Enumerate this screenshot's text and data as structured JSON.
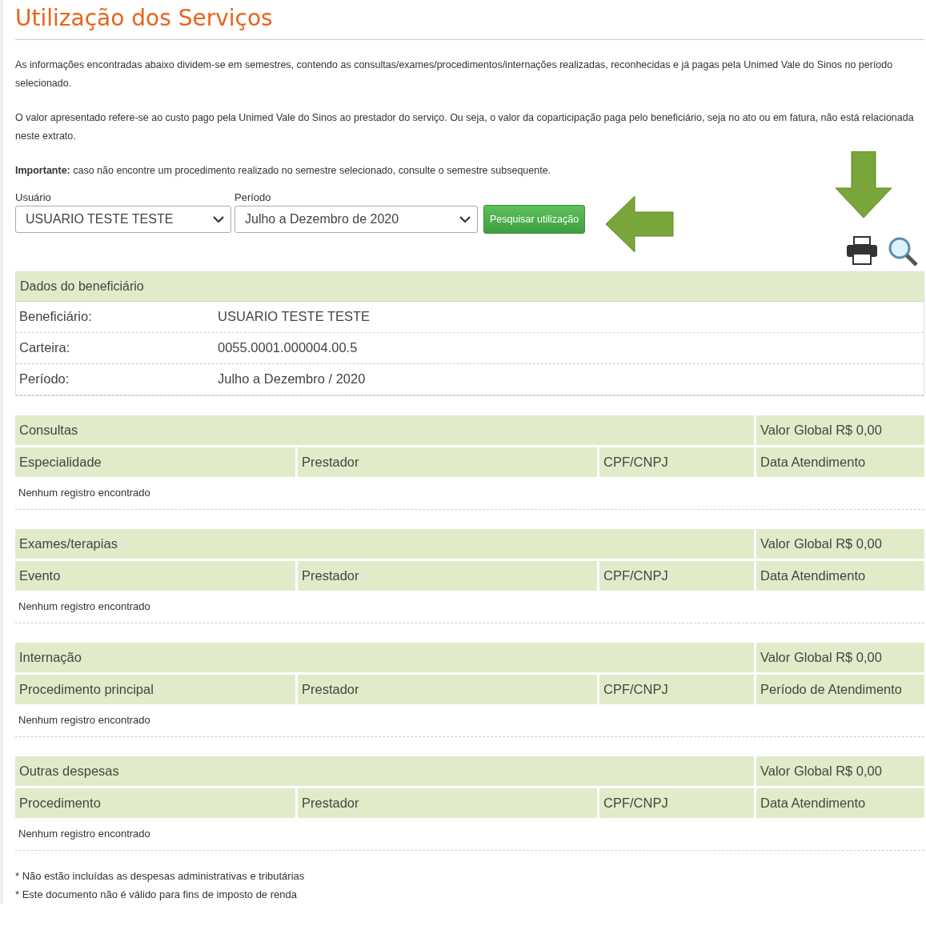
{
  "title": "Utilização dos Serviços",
  "paragraphs": [
    "As informações encontradas abaixo dividem-se em semestres, contendo as consultas/exames/procedimentos/internações realizadas, reconhecidas e já pagas pela Unimed Vale do Sinos no período selecionado.",
    "O valor apresentado refere-se ao custo pago pela Unimed Vale do Sinos ao prestador do serviço. Ou seja, o valor da coparticipação paga pelo beneficiário, seja no ato ou em fatura, não está relacionada neste extrato.",
    "**Importante:** caso não encontre um procedimento realizado no semestre selecionado, consulte o semestre subsequente."
  ],
  "filters": [
    {
      "label": "Usuário",
      "value": "USUARIO TESTE TESTE"
    },
    {
      "label": "Período",
      "value": "Julho a Dezembro de 2020"
    }
  ],
  "search_button": "Pesquisar utilização",
  "beneficiary": {
    "title": "Dados do beneficiário",
    "rows": [
      {
        "label": "Beneficiário:",
        "value": "USUARIO TESTE TESTE"
      },
      {
        "label": "Carteira:",
        "value": "0055.0001.000004.00.5"
      },
      {
        "label": "Período:",
        "value": "Julho a Dezembro / 2020"
      }
    ]
  },
  "sections": [
    {
      "title": "Consultas",
      "total": "Valor Global R$ 0,00",
      "columns": [
        "Especialidade",
        "Prestador",
        "CPF/CNPJ",
        "Data Atendimento"
      ],
      "empty": "Nenhum registro encontrado"
    },
    {
      "title": "Exames/terapias",
      "total": "Valor Global R$ 0,00",
      "columns": [
        "Evento",
        "Prestador",
        "CPF/CNPJ",
        "Data Atendimento"
      ],
      "empty": "Nenhum registro encontrado"
    },
    {
      "title": "Internação",
      "total": "Valor Global R$ 0,00",
      "columns": [
        "Procedimento principal",
        "Prestador",
        "CPF/CNPJ",
        "Período de Atendimento"
      ],
      "empty": "Nenhum registro encontrado"
    },
    {
      "title": "Outras despesas",
      "total": "Valor Global R$ 0,00",
      "columns": [
        "Procedimento",
        "Prestador",
        "CPF/CNPJ",
        "Data Atendimento"
      ],
      "empty": "Nenhum registro encontrado"
    }
  ],
  "footnotes": [
    "* Não estão incluídas as despesas administrativas e tributárias",
    "* Este documento não é válido para fins de imposto de renda"
  ]
}
